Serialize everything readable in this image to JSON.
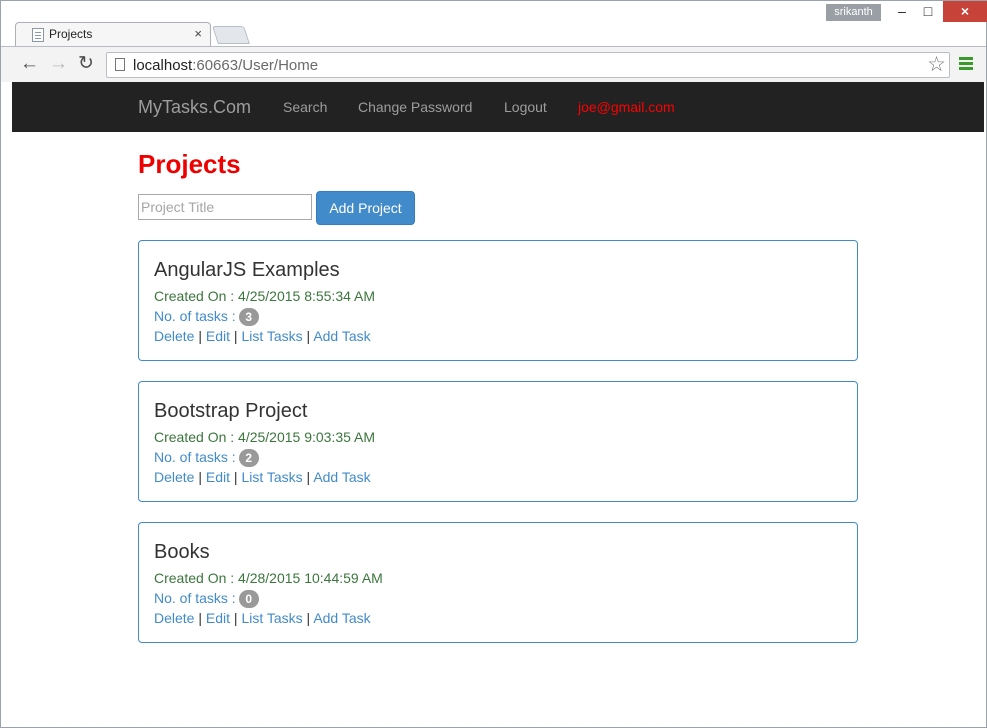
{
  "browser": {
    "tab_title": "Projects",
    "tab_close": "×",
    "user_chip": "srikanth",
    "url_host": "localhost",
    "url_rest": ":60663/User/Home",
    "win_min": "–",
    "win_max": "□",
    "win_close": "×",
    "back_icon": "←",
    "forward_icon": "→",
    "reload_icon": "↻",
    "star_icon": "☆"
  },
  "navbar": {
    "brand": "MyTasks.Com",
    "links": [
      "Search",
      "Change Password",
      "Logout"
    ],
    "user_email": "joe@gmail.com"
  },
  "page": {
    "title": "Projects",
    "input_placeholder": "Project Title",
    "add_button": "Add Project"
  },
  "labels": {
    "tasks_label": "No. of tasks :",
    "delete": "Delete",
    "edit": "Edit",
    "list_tasks": "List Tasks",
    "add_task": "Add Task",
    "separator": "|"
  },
  "projects": [
    {
      "name": "AngularJS Examples",
      "created": "Created On : 4/25/2015 8:55:34 AM",
      "task_count": "3"
    },
    {
      "name": "Bootstrap Project",
      "created": "Created On : 4/25/2015 9:03:35 AM",
      "task_count": "2"
    },
    {
      "name": "Books",
      "created": "Created On : 4/28/2015 10:44:59 AM",
      "task_count": "0"
    }
  ],
  "colors": {
    "navbar_bg": "#222222",
    "accent_blue": "#428bca",
    "title_red": "#ee0000",
    "created_green": "#3c763d",
    "badge_gray": "#999999"
  }
}
